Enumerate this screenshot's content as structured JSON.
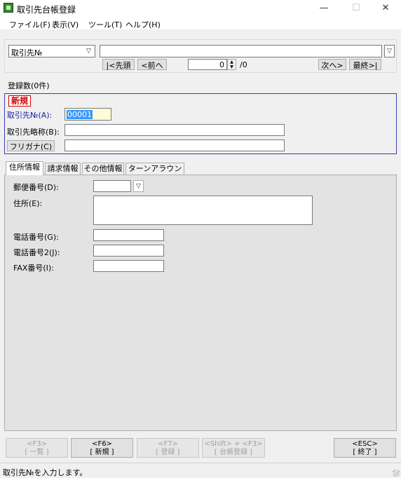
{
  "window": {
    "title": "取引先台帳登録"
  },
  "titlebar_buttons": {
    "minimize": "—",
    "maximize": "☐",
    "close": "✕"
  },
  "menu": [
    {
      "label": "ファイル(F)"
    },
    {
      "label": "表示(V)"
    },
    {
      "label": "ツール(T)"
    },
    {
      "label": "ヘルプ(H)"
    }
  ],
  "search": {
    "key_select": "取引先№",
    "value": "",
    "nav": {
      "first": "|<先頭",
      "prev": "<前へ",
      "next": "次へ>",
      "last": "最終>|"
    },
    "position": "0",
    "total": "/0"
  },
  "registered_count": "登録数(0件)",
  "form": {
    "mode_badge": "新規",
    "code_label": "取引先№(A):",
    "code_value": "00001",
    "name_label": "取引先略称(B):",
    "name_value": "",
    "kana_button": "フリガナ(C)",
    "kana_value": ""
  },
  "tabs": [
    {
      "label": "住所情報",
      "active": true
    },
    {
      "label": "請求情報",
      "active": false
    },
    {
      "label": "その他情報",
      "active": false
    },
    {
      "label": "ターンアラウンド用",
      "active": false
    }
  ],
  "address_tab": {
    "postal_label": "郵便番号(D):",
    "postal_value": "",
    "address_label": "住所(E):",
    "address_value": "",
    "phone_label": "電話番号(G):",
    "phone_value": "",
    "phone2_label": "電話番号2(J):",
    "phone2_value": "",
    "fax_label": "FAX番号(I):",
    "fax_value": ""
  },
  "function_keys": [
    {
      "key": "<F3>",
      "label": "[ 一覧 ]",
      "enabled": false
    },
    {
      "key": "<F6>",
      "label": "[ 新規 ]",
      "enabled": true
    },
    {
      "key": "<F7>",
      "label": "[ 登録 ]",
      "enabled": false
    },
    {
      "key": "<Shift> + <F3>",
      "label": "[ 台帳登録 ]",
      "enabled": false
    },
    {
      "key": "<ESC>",
      "label": "[ 終了 ]",
      "enabled": true
    }
  ],
  "status": {
    "text": "取引先№を入力します。"
  },
  "colors": {
    "accent_blue": "#3b3bb0",
    "label_blue": "#1a1aa8",
    "badge_red": "#d00000",
    "selection": "#3399ff"
  }
}
